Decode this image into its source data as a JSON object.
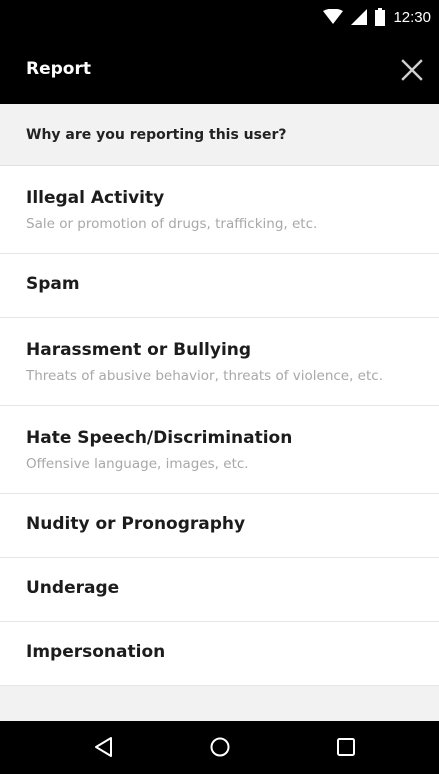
{
  "status_bar": {
    "time": "12:30",
    "icons": [
      "wifi-icon",
      "cell-signal-icon",
      "battery-icon"
    ]
  },
  "app_bar": {
    "title": "Report",
    "close_icon": "close-icon"
  },
  "question": "Why are you reporting this user?",
  "options": [
    {
      "title": "Illegal Activity",
      "subtitle": "Sale or promotion of drugs, trafficking, etc."
    },
    {
      "title": "Spam",
      "subtitle": ""
    },
    {
      "title": "Harassment or Bullying",
      "subtitle": "Threats of abusive behavior, threats of violence, etc."
    },
    {
      "title": "Hate Speech/Discrimination",
      "subtitle": "Offensive language, images, etc."
    },
    {
      "title": "Nudity or Pronography",
      "subtitle": ""
    },
    {
      "title": "Underage",
      "subtitle": ""
    },
    {
      "title": "Impersonation",
      "subtitle": ""
    }
  ],
  "nav_bar": {
    "icons": [
      "back-icon",
      "home-icon",
      "recents-icon"
    ]
  },
  "colors": {
    "bar_background": "#000000",
    "page_background": "#f2f2f2",
    "option_title": "#1c1c1c",
    "option_subtitle": "#a8a8a8"
  }
}
